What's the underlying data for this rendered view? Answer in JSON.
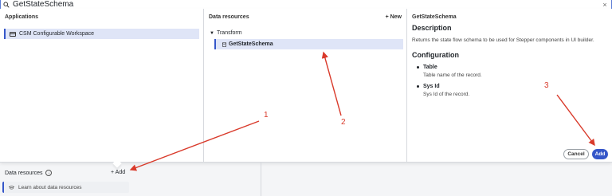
{
  "search": {
    "value": "GetStateSchema",
    "clear_label": "×"
  },
  "applications": {
    "header": "Applications",
    "items": [
      {
        "label": "CSM Configurable Workspace"
      }
    ]
  },
  "data_resources_col": {
    "header": "Data resources",
    "new_label": "+ New",
    "tree": {
      "parent_label": "Transform",
      "child_label": "GetStateSchema"
    }
  },
  "details": {
    "header": "GetStateSchema",
    "description_title": "Description",
    "description": "Returns the state flow schema to be used for Stepper components in UI builder.",
    "configuration_title": "Configuration",
    "fields": [
      {
        "name": "Table",
        "desc": "Table name of the record."
      },
      {
        "name": "Sys Id",
        "desc": "Sys Id of the record."
      }
    ],
    "cancel_label": "Cancel",
    "add_label": "Add"
  },
  "bottom": {
    "title": "Data resources",
    "info_icon": "i",
    "add_label": "+ Add",
    "learn_label": "Learn about data resources"
  },
  "annotations": {
    "color": "#d93a2b",
    "labels": [
      "1",
      "2",
      "3"
    ]
  },
  "colors": {
    "accent": "#3556c9",
    "selection": "#dfe5f7"
  }
}
